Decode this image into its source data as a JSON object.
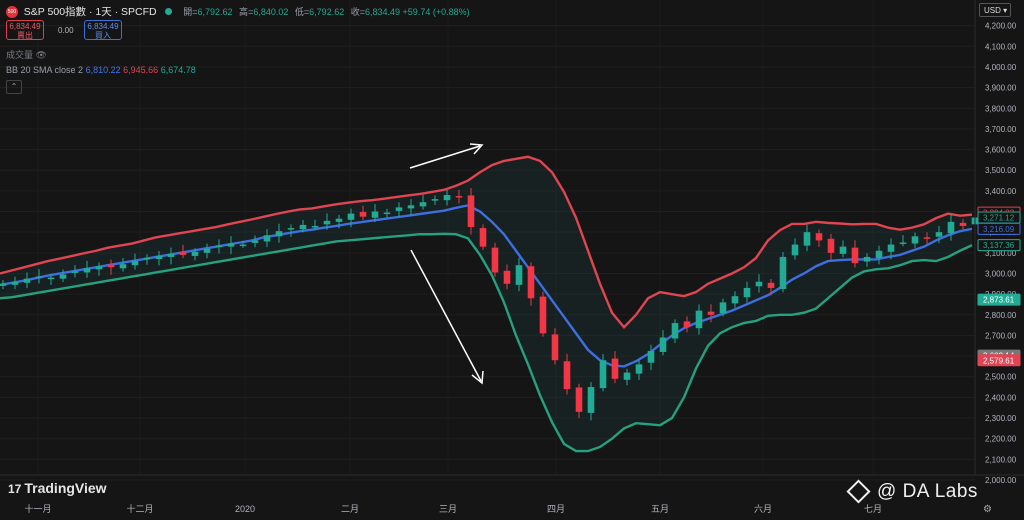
{
  "header": {
    "logo_text": "500",
    "title": "S&P 500指數 · 1天 · SPCFD",
    "ohlc": [
      {
        "label": "開",
        "value": "6,792.62"
      },
      {
        "label": "高",
        "value": "6,840.02"
      },
      {
        "label": "低",
        "value": "6,792.62"
      },
      {
        "label": "收",
        "value": "6,834.49 +59.74 (+0.88%)"
      }
    ]
  },
  "trade": {
    "sell_price": "6,834.49",
    "sell_label": "賣出",
    "spread": "0.00",
    "buy_price": "6,834.49",
    "buy_label": "買入"
  },
  "volume_label": "成交量",
  "indicator": {
    "name": "BB 20 SMA close 2",
    "middle": "6,810.22",
    "upper": "6,945.66",
    "lower": "6,674.78"
  },
  "currency": "USD",
  "branding": {
    "tradingview": "TradingView",
    "watermark": "@ DA  Labs"
  },
  "colors": {
    "up": "#22ab94",
    "down": "#f23645",
    "upper_band": "#e04551",
    "middle_band": "#3d6fe0",
    "lower_band": "#26a17f",
    "background": "#151515"
  },
  "chart_data": {
    "type": "candlestick",
    "y_axis": {
      "min": 2000,
      "max": 4300,
      "ticks": [
        "2,000.00",
        "2,100.00",
        "2,200.00",
        "2,300.00",
        "2,400.00",
        "2,500.00",
        "2,600.00",
        "2,700.00",
        "2,800.00",
        "2,900.00",
        "3,000.00",
        "3,100.00",
        "3,200.00",
        "3,300.00",
        "3,400.00",
        "3,500.00",
        "3,600.00",
        "3,700.00",
        "3,800.00",
        "3,900.00",
        "4,000.00",
        "4,100.00",
        "4,200.00"
      ]
    },
    "x_axis": {
      "labels": [
        "十一月",
        "十二月",
        "2020",
        "二月",
        "三月",
        "四月",
        "五月",
        "六月",
        "七月"
      ]
    },
    "price_labels": [
      {
        "text": "3,294.82",
        "color": "#e04551",
        "style": "outline",
        "value": 3294.82
      },
      {
        "text": "3,271.12",
        "color": "#22ab94",
        "style": "outline",
        "value": 3271.12
      },
      {
        "text": "3,216.09",
        "color": "#3d6fe0",
        "style": "outline",
        "value": 3216.09
      },
      {
        "text": "3,137.36",
        "color": "#22ab94",
        "style": "outline",
        "value": 3137.36
      },
      {
        "text": "2,873.61",
        "color": "#22ab94",
        "style": "filled",
        "value": 2873.61
      },
      {
        "text": "2,602.14",
        "color": "#777777",
        "style": "filled",
        "value": 2602.14
      },
      {
        "text": "2,579.61",
        "color": "#e04551",
        "style": "filled",
        "value": 2579.61
      }
    ],
    "bands": {
      "upper": [
        3000,
        3015,
        3030,
        3045,
        3060,
        3072,
        3085,
        3098,
        3110,
        3125,
        3135,
        3145,
        3160,
        3175,
        3185,
        3195,
        3205,
        3215,
        3225,
        3238,
        3250,
        3262,
        3275,
        3288,
        3300,
        3310,
        3315,
        3325,
        3335,
        3343,
        3350,
        3355,
        3362,
        3370,
        3378,
        3385,
        3395,
        3405,
        3425,
        3450,
        3490,
        3525,
        3545,
        3555,
        3565,
        3545,
        3490,
        3395,
        3270,
        3110,
        2950,
        2810,
        2740,
        2800,
        2880,
        2910,
        2900,
        2890,
        2910,
        2950,
        2975,
        3000,
        3030,
        3075,
        3160,
        3210,
        3240,
        3240,
        3250,
        3245,
        3242,
        3238,
        3240,
        3240,
        3222,
        3212,
        3222,
        3238,
        3268,
        3290,
        3280,
        3285
      ],
      "middle": [
        2945,
        2955,
        2965,
        2978,
        2990,
        3000,
        3010,
        3020,
        3030,
        3040,
        3050,
        3060,
        3070,
        3080,
        3090,
        3100,
        3110,
        3120,
        3130,
        3140,
        3150,
        3160,
        3175,
        3185,
        3195,
        3205,
        3212,
        3222,
        3230,
        3240,
        3248,
        3256,
        3264,
        3272,
        3280,
        3288,
        3296,
        3304,
        3318,
        3330,
        3300,
        3250,
        3190,
        3110,
        3030,
        2950,
        2870,
        2790,
        2710,
        2630,
        2580,
        2555,
        2550,
        2575,
        2610,
        2655,
        2700,
        2735,
        2760,
        2780,
        2800,
        2820,
        2845,
        2870,
        2895,
        2930,
        2970,
        3000,
        3035,
        3060,
        3065,
        3068,
        3068,
        3068,
        3080,
        3090,
        3110,
        3130,
        3160,
        3185,
        3205,
        3216
      ],
      "lower": [
        2880,
        2885,
        2895,
        2905,
        2915,
        2925,
        2935,
        2945,
        2955,
        2965,
        2975,
        2985,
        2995,
        3005,
        3015,
        3025,
        3035,
        3045,
        3055,
        3065,
        3075,
        3085,
        3095,
        3105,
        3115,
        3125,
        3135,
        3145,
        3155,
        3160,
        3165,
        3170,
        3175,
        3180,
        3185,
        3190,
        3190,
        3192,
        3190,
        3170,
        3090,
        2990,
        2860,
        2700,
        2560,
        2410,
        2280,
        2175,
        2140,
        2140,
        2160,
        2200,
        2250,
        2275,
        2270,
        2265,
        2300,
        2400,
        2540,
        2650,
        2710,
        2740,
        2760,
        2770,
        2795,
        2800,
        2800,
        2810,
        2830,
        2880,
        2930,
        2980,
        3010,
        3020,
        3025,
        3040,
        3060,
        3065,
        3060,
        3080,
        3110,
        3137
      ]
    },
    "series": [
      {
        "kind": "candles",
        "close": [
          2950,
          2960,
          2975,
          2985,
          2980,
          2995,
          3010,
          3025,
          3035,
          3030,
          3045,
          3060,
          3075,
          3085,
          3095,
          3090,
          3105,
          3120,
          3135,
          3145,
          3140,
          3160,
          3185,
          3205,
          3220,
          3235,
          3230,
          3255,
          3265,
          3290,
          3275,
          3300,
          3295,
          3320,
          3330,
          3345,
          3360,
          3380,
          3370,
          3225,
          3130,
          3005,
          2950,
          3040,
          2880,
          2710,
          2580,
          2440,
          2330,
          2450,
          2580,
          2490,
          2520,
          2560,
          2625,
          2690,
          2760,
          2740,
          2820,
          2800,
          2860,
          2890,
          2930,
          2960,
          2930,
          3080,
          3140,
          3200,
          3160,
          3100,
          3130,
          3050,
          3080,
          3110,
          3140,
          3150,
          3180,
          3170,
          3200,
          3250,
          3230,
          3271
        ]
      }
    ],
    "annotations": [
      {
        "type": "arrow",
        "description": "up-right arrow above peak"
      },
      {
        "type": "arrow",
        "description": "down-right arrow along decline"
      }
    ]
  }
}
